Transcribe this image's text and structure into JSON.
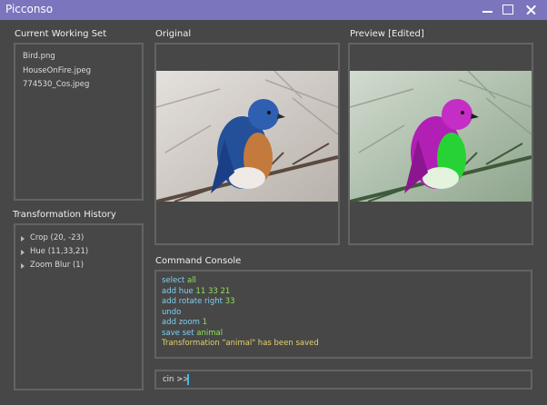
{
  "app": {
    "title": "Picconso"
  },
  "working_set": {
    "title": "Current Working Set",
    "files": [
      "Bird.png",
      "HouseOnFire.jpeg",
      "774530_Cos.jpeg"
    ]
  },
  "history": {
    "title": "Transformation History",
    "items": [
      "Crop (20, -23)",
      "Hue (11,33,21)",
      "Zoom Blur (1)"
    ]
  },
  "original": {
    "title": "Original"
  },
  "preview": {
    "title": "Preview [Edited]"
  },
  "console": {
    "title": "Command Console",
    "lines": [
      {
        "cmd": "select",
        "args": "all"
      },
      {
        "cmd": "add hue",
        "args": "11 33 21"
      },
      {
        "cmd": "add rotate right",
        "args": "33"
      },
      {
        "cmd": "undo",
        "args": ""
      },
      {
        "cmd": "add zoom",
        "args": "1"
      },
      {
        "cmd": "save set",
        "args": "animal"
      }
    ],
    "message": "Transformation \"animal\" has been saved",
    "prompt": "cin >>",
    "input_value": ""
  },
  "colors": {
    "titlebar": "#7b75be",
    "background": "#474747",
    "panel_border": "#636363",
    "command": "#7fd0f0",
    "argument": "#8ee25c",
    "message": "#e5d26a",
    "caret": "#49b7e8"
  },
  "icons": [
    "minimize-icon",
    "maximize-icon",
    "close-icon",
    "expand-triangle-icon"
  ]
}
